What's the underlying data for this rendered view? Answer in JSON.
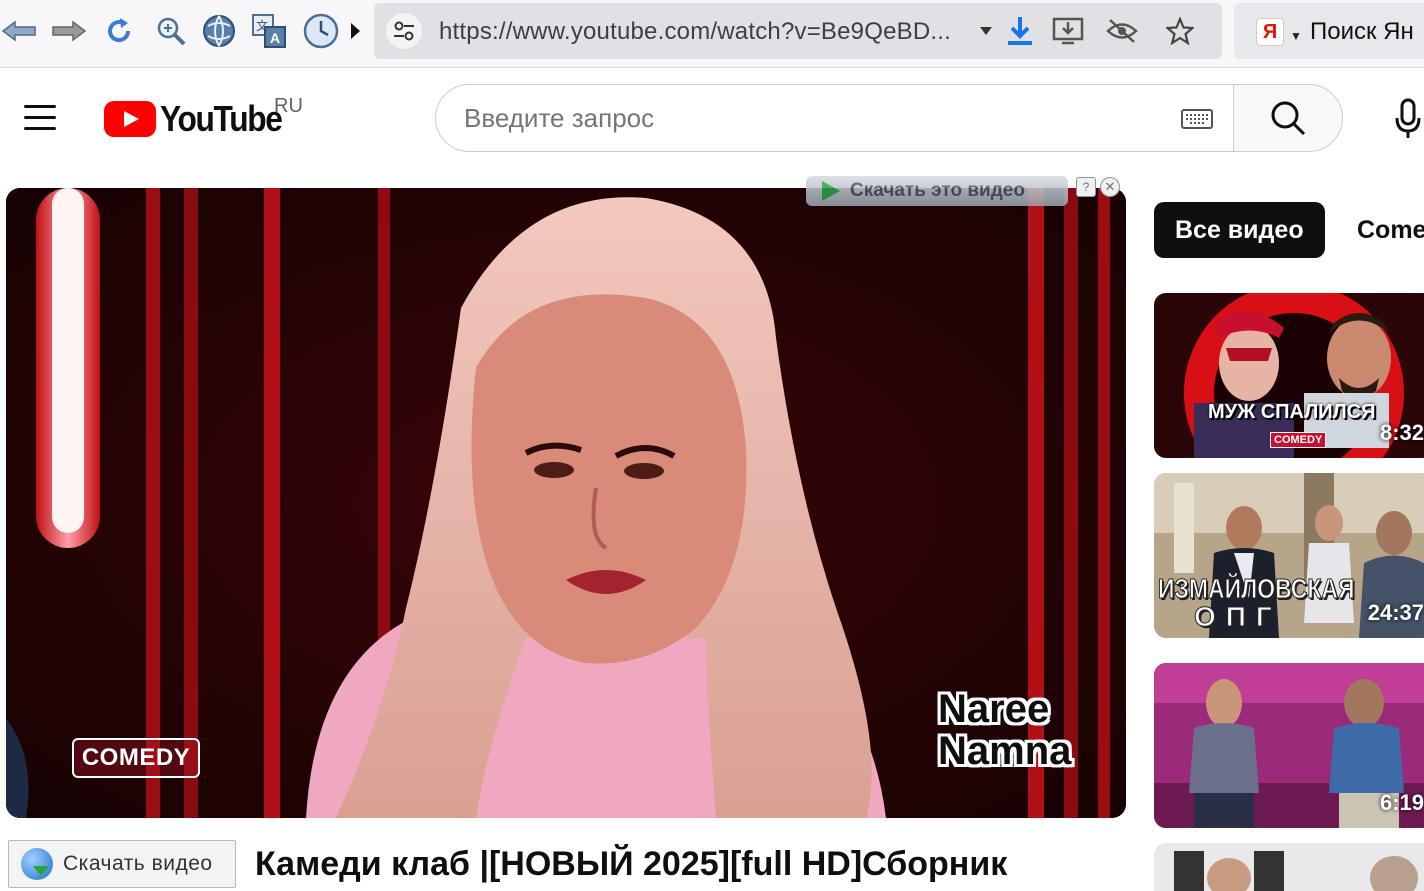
{
  "browser": {
    "url": "https://www.youtube.com/watch?v=Be9QeBD...",
    "search_provider_text": "Поиск Ян",
    "yandex_letter": "Я"
  },
  "youtube": {
    "logo_text": "YouTube",
    "country_code": "RU",
    "search_placeholder": "Введите запрос"
  },
  "player": {
    "download_overlay_text": "Скачать это видео",
    "overlay_help": "?",
    "overlay_close": "✕",
    "brand_badge": "COMEDY",
    "name_line1": "Naree",
    "name_line2": "Namna"
  },
  "below_player": {
    "download_button_text": "Скачать видео",
    "video_title": "Камеди клаб |[НОВЫЙ 2025][full HD]Сборник"
  },
  "sidebar": {
    "chips": [
      "Все видео",
      "Comedy"
    ],
    "recommendations": [
      {
        "caption": "МУЖ СПАЛИЛСЯ",
        "badge": "COMEDY",
        "duration": "8:32"
      },
      {
        "caption_line1": "ИЗМАЙЛОВСКАЯ",
        "caption_line2": "ОПГ",
        "duration": "24:37"
      },
      {
        "duration": "6:19"
      },
      {}
    ]
  }
}
